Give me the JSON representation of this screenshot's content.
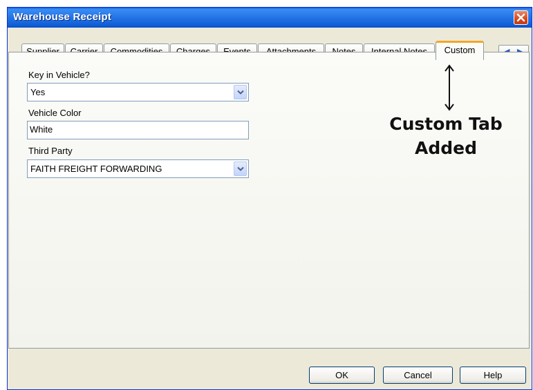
{
  "window": {
    "title": "Warehouse Receipt"
  },
  "tabs": [
    {
      "label": "Supplier"
    },
    {
      "label": "Carrier"
    },
    {
      "label": "Commodities"
    },
    {
      "label": "Charges"
    },
    {
      "label": "Events"
    },
    {
      "label": "Attachments"
    },
    {
      "label": "Notes"
    },
    {
      "label": "Internal Notes"
    },
    {
      "label": "Custom",
      "active": true
    }
  ],
  "tab_scroll": {
    "left": "◀",
    "right": "▶"
  },
  "form": {
    "key_in_vehicle": {
      "label": "Key in Vehicle?",
      "value": "Yes"
    },
    "vehicle_color": {
      "label": "Vehicle Color",
      "value": "White"
    },
    "third_party": {
      "label": "Third Party",
      "value": "FAITH FREIGHT FORWARDING"
    }
  },
  "annotation": {
    "line1": "Custom Tab",
    "line2": "Added"
  },
  "buttons": {
    "ok": "OK",
    "cancel": "Cancel",
    "help": "Help"
  },
  "colors": {
    "titlebar": "#0f5dd6",
    "active_tab_accent": "#f5a623",
    "close_button": "#d64a1e"
  },
  "icons": {
    "close": "close-icon",
    "dropdown": "chevron-down-icon",
    "annotation_arrow": "double-arrow-icon"
  }
}
